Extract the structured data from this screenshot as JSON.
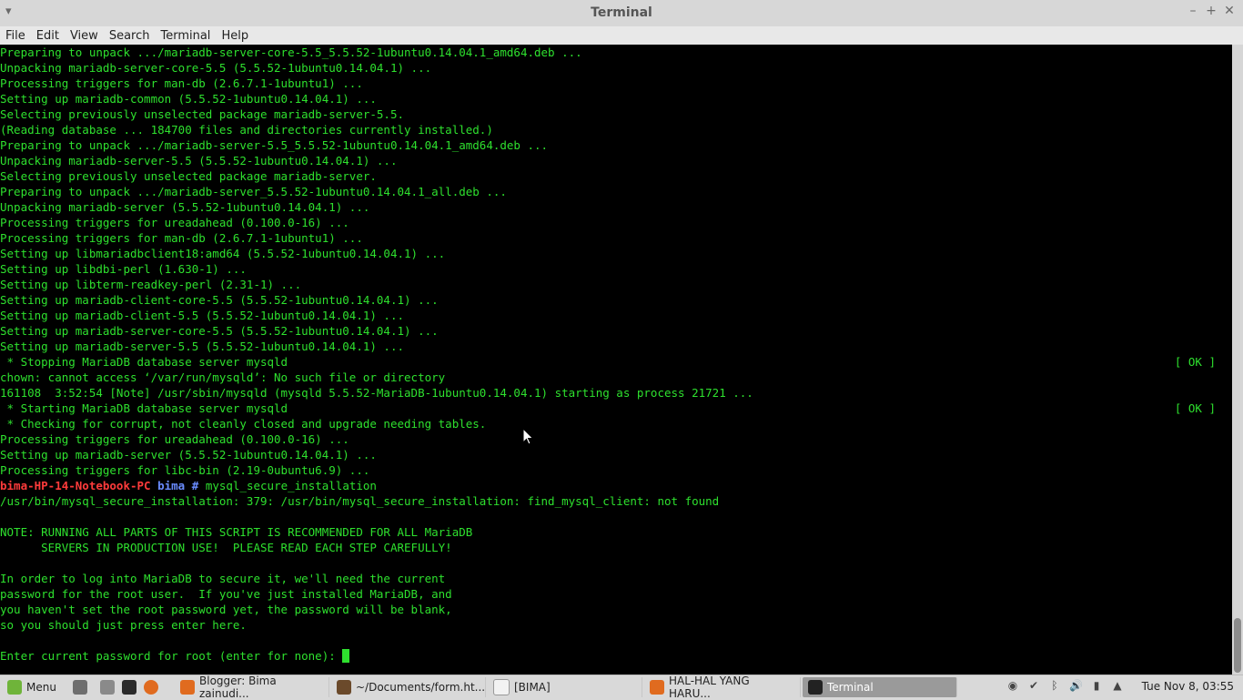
{
  "window": {
    "title": "Terminal",
    "menu": [
      "File",
      "Edit",
      "View",
      "Search",
      "Terminal",
      "Help"
    ]
  },
  "terminal": {
    "lines": [
      "Preparing to unpack .../mariadb-server-core-5.5_5.5.52-1ubuntu0.14.04.1_amd64.deb ...",
      "Unpacking mariadb-server-core-5.5 (5.5.52-1ubuntu0.14.04.1) ...",
      "Processing triggers for man-db (2.6.7.1-1ubuntu1) ...",
      "Setting up mariadb-common (5.5.52-1ubuntu0.14.04.1) ...",
      "Selecting previously unselected package mariadb-server-5.5.",
      "(Reading database ... 184700 files and directories currently installed.)",
      "Preparing to unpack .../mariadb-server-5.5_5.5.52-1ubuntu0.14.04.1_amd64.deb ...",
      "Unpacking mariadb-server-5.5 (5.5.52-1ubuntu0.14.04.1) ...",
      "Selecting previously unselected package mariadb-server.",
      "Preparing to unpack .../mariadb-server_5.5.52-1ubuntu0.14.04.1_all.deb ...",
      "Unpacking mariadb-server (5.5.52-1ubuntu0.14.04.1) ...",
      "Processing triggers for ureadahead (0.100.0-16) ...",
      "Processing triggers for man-db (2.6.7.1-1ubuntu1) ...",
      "Setting up libmariadbclient18:amd64 (5.5.52-1ubuntu0.14.04.1) ...",
      "Setting up libdbi-perl (1.630-1) ...",
      "Setting up libterm-readkey-perl (2.31-1) ...",
      "Setting up mariadb-client-core-5.5 (5.5.52-1ubuntu0.14.04.1) ...",
      "Setting up mariadb-client-5.5 (5.5.52-1ubuntu0.14.04.1) ...",
      "Setting up mariadb-server-core-5.5 (5.5.52-1ubuntu0.14.04.1) ...",
      "Setting up mariadb-server-5.5 (5.5.52-1ubuntu0.14.04.1) ...",
      " * Stopping MariaDB database server mysqld",
      "chown: cannot access ‘/var/run/mysqld’: No such file or directory",
      "161108  3:52:54 [Note] /usr/sbin/mysqld (mysqld 5.5.52-MariaDB-1ubuntu0.14.04.1) starting as process 21721 ...",
      " * Starting MariaDB database server mysqld",
      " * Checking for corrupt, not cleanly closed and upgrade needing tables.",
      "Processing triggers for ureadahead (0.100.0-16) ...",
      "Setting up mariadb-server (5.5.52-1ubuntu0.14.04.1) ...",
      "Processing triggers for libc-bin (2.19-0ubuntu6.9) ..."
    ],
    "ok_label": "[ OK ]",
    "ok_line_indices": [
      20,
      23
    ],
    "prompt": {
      "host": "bima-HP-14-Notebook-PC",
      "dir": "bima",
      "symbol": "#",
      "command": "mysql_secure_installation"
    },
    "after_lines": [
      "/usr/bin/mysql_secure_installation: 379: /usr/bin/mysql_secure_installation: find_mysql_client: not found",
      "",
      "NOTE: RUNNING ALL PARTS OF THIS SCRIPT IS RECOMMENDED FOR ALL MariaDB",
      "      SERVERS IN PRODUCTION USE!  PLEASE READ EACH STEP CAREFULLY!",
      "",
      "In order to log into MariaDB to secure it, we'll need the current",
      "password for the root user.  If you've just installed MariaDB, and",
      "you haven't set the root password yet, the password will be blank,",
      "so you should just press enter here.",
      "",
      "Enter current password for root (enter for none): "
    ]
  },
  "taskbar": {
    "menu_label": "Menu",
    "tasks": [
      {
        "label": "Blogger: Bima zainudi...",
        "icon_color": "#e06b1f"
      },
      {
        "label": "~/Documents/form.ht...",
        "icon_color": "#6b4a2b"
      },
      {
        "label": "[BIMA]",
        "icon_color": "#f2f2f2"
      },
      {
        "label": "HAL-HAL YANG HARU...",
        "icon_color": "#e06b1f"
      },
      {
        "label": "Terminal",
        "icon_color": "#222222"
      }
    ],
    "clock": "Tue Nov  8, 03:55"
  },
  "colors": {
    "terminal_fg": "#2ee02e",
    "prompt_host": "#ff3b3b",
    "prompt_dir": "#6a8cff"
  }
}
